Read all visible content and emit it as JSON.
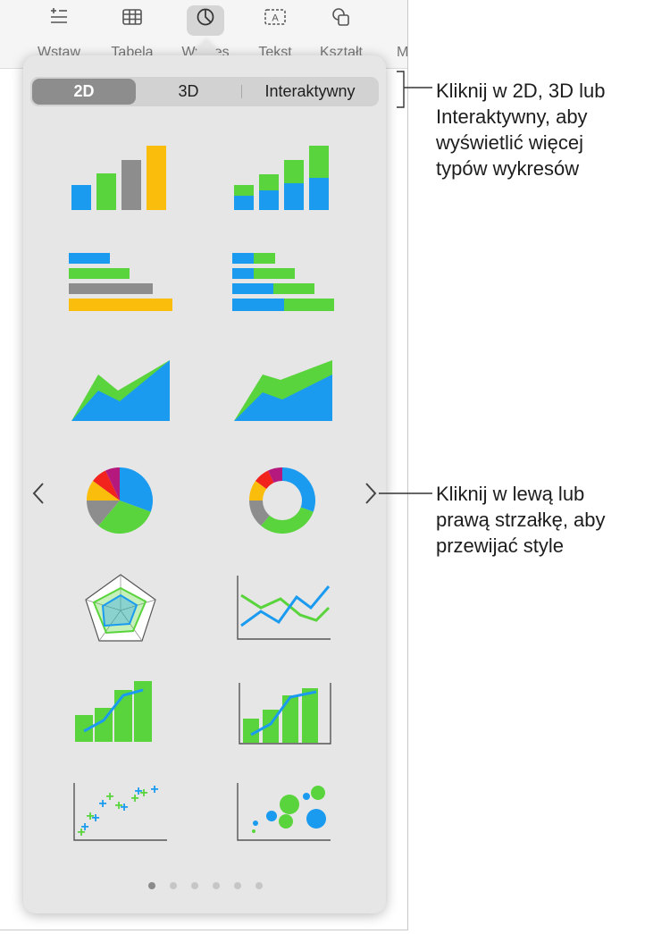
{
  "toolbar": {
    "insert_label": "Wstaw",
    "table_label": "Tabela",
    "charts_label": "Wykres",
    "text_label": "Tekst",
    "shape_label": "Kształt",
    "media_label": "Multimedia",
    "text_icon_glyph": "A"
  },
  "chart_picker": {
    "tabs": [
      "2D",
      "3D",
      "Interaktywny"
    ],
    "active_tab": "2D",
    "chart_styles": [
      "column-chart",
      "stacked-column-chart",
      "bar-chart",
      "stacked-bar-chart",
      "area-chart",
      "stacked-area-chart",
      "pie-chart",
      "donut-chart",
      "radar-chart",
      "line-chart",
      "mixed-column-line-chart",
      "two-axis-chart",
      "scatter-chart",
      "bubble-chart"
    ],
    "page_count": 6,
    "current_page": 1
  },
  "colors": {
    "blue": "#1b9bf0",
    "green": "#5ad43c",
    "gray": "#8d8d8d",
    "yellow": "#fbbd0c",
    "red": "#f2231c",
    "purple": "#b5197e",
    "popover_bg": "#e6e6e6"
  },
  "callouts": {
    "tabs_hint": "Kliknij w 2D, 3D lub\nInteraktywny, aby\nwyświetlić więcej\ntypów wykresów",
    "arrows_hint": "Kliknij w lewą lub\nprawą strzałkę, aby\nprzewijać style"
  }
}
